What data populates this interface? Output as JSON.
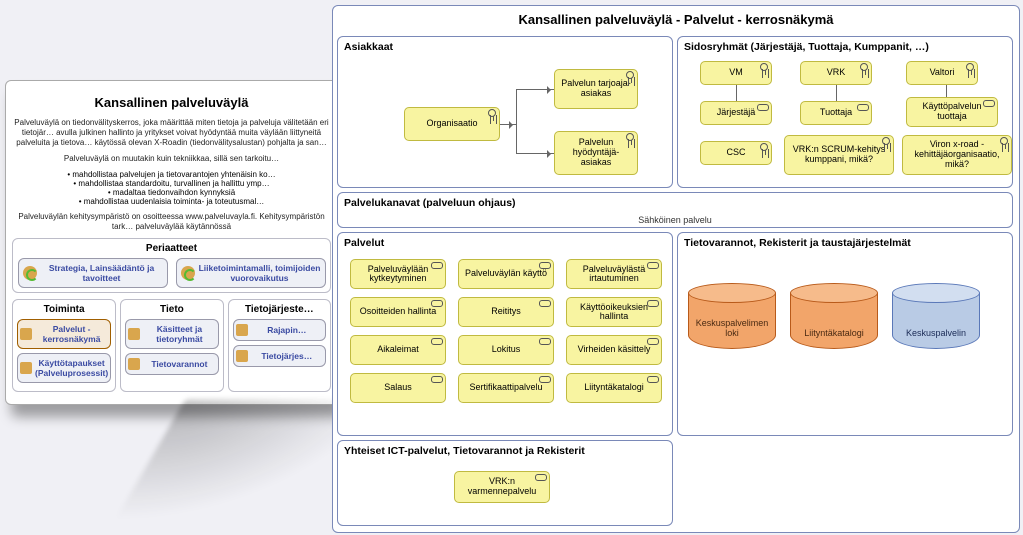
{
  "overview": {
    "title": "Kansallinen palveluväylä",
    "desc1": "Palveluväylä on tiedonvälityskerros, joka määrittää miten tietoja ja palveluja välitetään eri tietojär… avulla julkinen hallinto ja yritykset voivat hyödyntää muita väylään liittyneitä palveluita ja tietova… käytössä olevan X-Roadin (tiedonvälitysalustan) pohjalta ja san…",
    "desc2": "Palveluväylä on muutakin kuin tekniikkaa, sillä sen tarkoitu…",
    "bullets": [
      "mahdollistaa palvelujen ja tietovarantojen yhtenäisin ko…",
      "mahdollistaa standardoitu, turvallinen ja hallittu ymp…",
      "madaltaa tiedonvaihdon kynnyksiä",
      "mahdollistaa uudenlaisia toiminta- ja toteutusmal…"
    ],
    "desc3": "Palveluväylän kehitysympäristö on osoitteessa www.palveluvayla.fi. Kehitysympäristön tark… palveluväylää käytännössä",
    "periaatteet_head": "Periaatteet",
    "periaatteet": [
      "Strategia, Lainsäädäntö ja tavoitteet",
      "Liiketoimintamalli, toimijoiden vuorovaikutus"
    ],
    "columns": [
      {
        "head": "Toiminta",
        "items": [
          "Palvelut - kerrosnäkymä",
          "Käyttötapaukset (Palveluprosessit)"
        ],
        "selected_index": 0
      },
      {
        "head": "Tieto",
        "items": [
          "Käsitteet ja tietoryhmät",
          "Tietovarannot"
        ]
      },
      {
        "head": "Tietojärjeste…",
        "items": [
          "Rajapin…",
          "Tietojärjes…"
        ]
      }
    ]
  },
  "big": {
    "title": "Kansallinen palveluväylä - Palvelut - kerrosnäkymä",
    "asiakkaat": {
      "title": "Asiakkaat",
      "organisaatio": "Organisaatio",
      "tarjoaja": "Palvelun tarjoaja-asiakas",
      "hyodyntaja": "Palvelun hyödyntäjä-asiakas"
    },
    "sidosryhmat": {
      "title": "Sidosryhmät (Järjestäjä, Tuottaja, Kumppanit, …)",
      "row1": [
        "VM",
        "VRK",
        "Valtori"
      ],
      "row2": [
        "Järjestäjä",
        "Tuottaja",
        "Käyttöpalvelun tuottaja"
      ],
      "row3": [
        "CSC",
        "VRK:n SCRUM-kehitys kumppani, mikä?",
        "Viron x-road -kehittäjäorganisaatio, mikä?"
      ]
    },
    "kanavat": {
      "title": "Palvelukanavat (palveluun ohjaus)",
      "subtitle": "Sähköinen palvelu"
    },
    "palvelut": {
      "title": "Palvelut",
      "items": [
        "Palveluväylään kytkeytyminen",
        "Palveluväylän käyttö",
        "Palveluväylästä irtautuminen",
        "Osoitteiden hallinta",
        "Reititys",
        "Käyttöoikeuksien hallinta",
        "Aikaleimat",
        "Lokitus",
        "Virheiden käsittely",
        "Salaus",
        "Sertifikaattipalvelu",
        "Liityntäkatalogi"
      ]
    },
    "tietovarannot": {
      "title": "Tietovarannot, Rekisterit ja taustajärjestelmät",
      "cyls": [
        "Keskuspalvelimen loki",
        "Liityntäkatalogi",
        "Keskuspalvelin"
      ]
    },
    "ict": {
      "title": "Yhteiset ICT-palvelut, Tietovarannot ja Rekisterit",
      "item": "VRK:n varmennepalvelu"
    }
  }
}
